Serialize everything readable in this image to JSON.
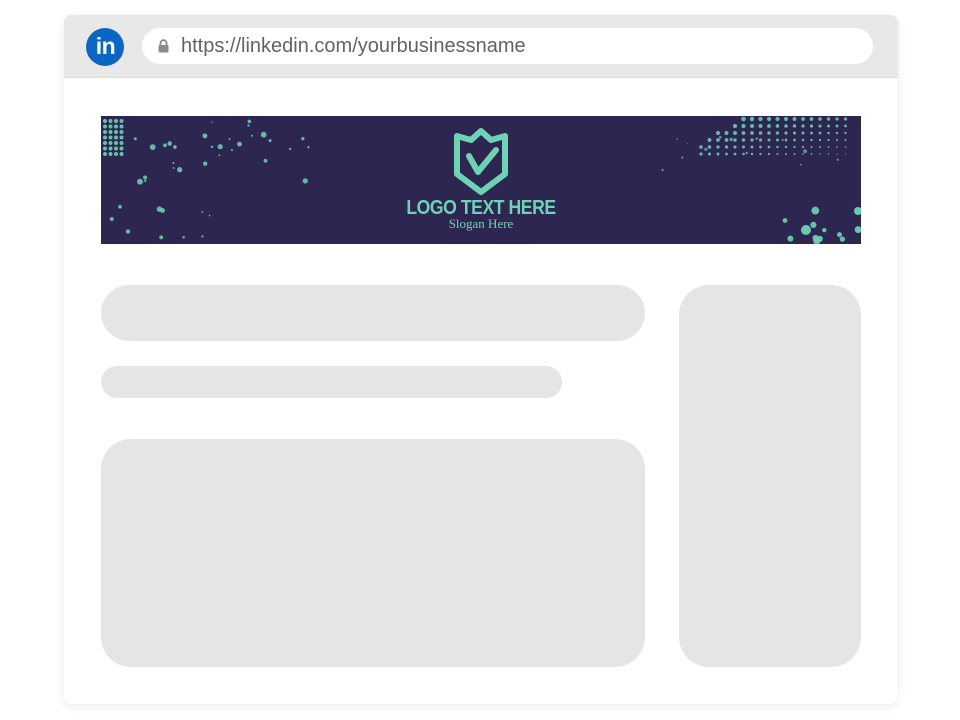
{
  "browser": {
    "logo_icon": "linkedin-icon",
    "logo_text": "in",
    "logo_color": "#0a66c2",
    "lock_icon": "lock-icon",
    "url": "https://linkedin.com/yourbusinessname"
  },
  "banner": {
    "background_color": "#2d2650",
    "accent_color": "#6dd3b4",
    "logo_text": "LOGO TEXT HERE",
    "slogan": "Slogan Here"
  },
  "placeholders": {
    "color": "#e5e5e5"
  }
}
